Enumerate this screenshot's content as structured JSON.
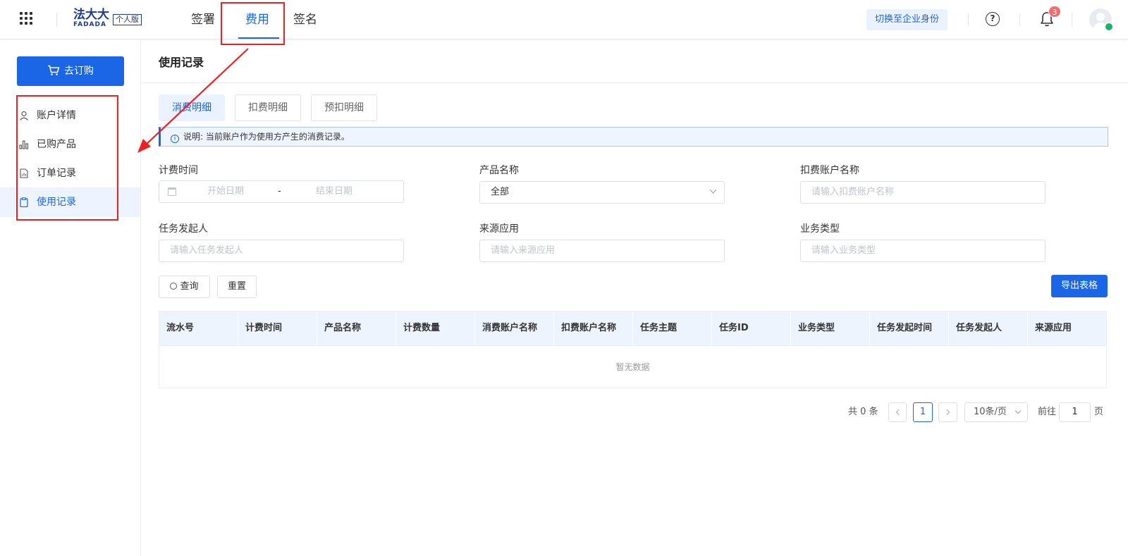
{
  "header": {
    "logo_text": "法大大",
    "logo_sub": "FADADA",
    "logo_badge": "个人版",
    "nav": [
      {
        "label": "签署",
        "active": false
      },
      {
        "label": "费用",
        "active": true
      },
      {
        "label": "签名",
        "active": false
      }
    ],
    "switch_identity": "切换至企业身份",
    "help": "?",
    "notification_count": "3"
  },
  "sidebar": {
    "order_button": "去订购",
    "items": [
      {
        "label": "账户详情",
        "icon": "user-icon",
        "active": false
      },
      {
        "label": "已购产品",
        "icon": "bar-chart-icon",
        "active": false
      },
      {
        "label": "订单记录",
        "icon": "document-chart-icon",
        "active": false
      },
      {
        "label": "使用记录",
        "icon": "clipboard-icon",
        "active": true
      }
    ]
  },
  "main": {
    "title": "使用记录",
    "tabs": [
      {
        "label": "消费明细",
        "active": true
      },
      {
        "label": "扣费明细",
        "active": false
      },
      {
        "label": "预扣明细",
        "active": false
      }
    ],
    "notice": "说明: 当前账户作为使用方产生的消费记录。",
    "filters": {
      "billing_time": {
        "label": "计费时间",
        "start_placeholder": "开始日期",
        "separator": "-",
        "end_placeholder": "结束日期"
      },
      "product_name": {
        "label": "产品名称",
        "value": "全部"
      },
      "deduct_account": {
        "label": "扣费账户名称",
        "placeholder": "请输入扣费账户名称"
      },
      "task_initiator": {
        "label": "任务发起人",
        "placeholder": "请输入任务发起人"
      },
      "source_app": {
        "label": "来源应用",
        "placeholder": "请输入来源应用"
      },
      "business_type": {
        "label": "业务类型",
        "placeholder": "请输入业务类型"
      }
    },
    "buttons": {
      "query": "查询",
      "reset": "重置",
      "export": "导出表格"
    },
    "table": {
      "columns": [
        "流水号",
        "计费时间",
        "产品名称",
        "计费数量",
        "消费账户名称",
        "扣费账户名称",
        "任务主题",
        "任务ID",
        "业务类型",
        "任务发起时间",
        "任务发起人",
        "来源应用"
      ],
      "empty_text": "暂无数据"
    },
    "pagination": {
      "total": "共 0 条",
      "current_page": "1",
      "page_size": "10条/页",
      "goto_label": "前往",
      "goto_value": "1",
      "page_suffix": "页"
    }
  },
  "colors": {
    "primary": "#1a66e6",
    "annotation": "#f02020",
    "badge": "#f56c6c"
  }
}
